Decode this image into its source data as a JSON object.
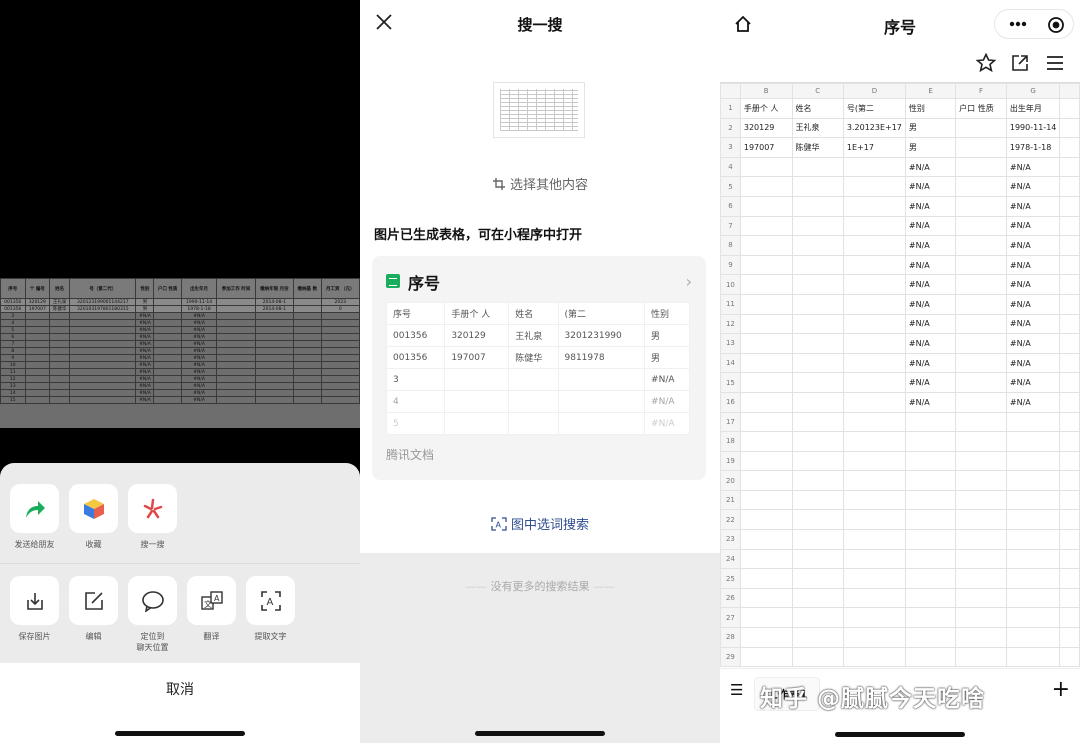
{
  "panel1": {
    "photo": {
      "headers": [
        "序号",
        "个\n编号",
        "姓名",
        "号（第二代）",
        "性别",
        "户口\n性质",
        "出生年月",
        "参加工作\n时间",
        "缴纳年限\n月份",
        "缴纳基\n数",
        "月工资\n（元）"
      ],
      "rows": [
        [
          "001356",
          "320129",
          "王礼泉",
          "320123199001144217",
          "男",
          "",
          "1990-11-14",
          "",
          "2014-08-1",
          "",
          "2023"
        ],
        [
          "001356",
          "197007",
          "陈健华",
          "320103197801180315",
          "男",
          "",
          "1978-1-18",
          "",
          "2014-08-1",
          "",
          "0"
        ],
        [
          "3",
          "",
          "",
          "",
          "#N/A",
          "",
          "#N/A",
          "",
          "",
          "",
          ""
        ],
        [
          "4",
          "",
          "",
          "",
          "#N/A",
          "",
          "#N/A",
          "",
          "",
          "",
          ""
        ],
        [
          "5",
          "",
          "",
          "",
          "#N/A",
          "",
          "#N/A",
          "",
          "",
          "",
          ""
        ],
        [
          "6",
          "",
          "",
          "",
          "#N/A",
          "",
          "#N/A",
          "",
          "",
          "",
          ""
        ],
        [
          "7",
          "",
          "",
          "",
          "#N/A",
          "",
          "#N/A",
          "",
          "",
          "",
          ""
        ],
        [
          "8",
          "",
          "",
          "",
          "#N/A",
          "",
          "#N/A",
          "",
          "",
          "",
          ""
        ],
        [
          "9",
          "",
          "",
          "",
          "#N/A",
          "",
          "#N/A",
          "",
          "",
          "",
          ""
        ],
        [
          "10",
          "",
          "",
          "",
          "#N/A",
          "",
          "#N/A",
          "",
          "",
          "",
          ""
        ],
        [
          "11",
          "",
          "",
          "",
          "#N/A",
          "",
          "#N/A",
          "",
          "",
          "",
          ""
        ],
        [
          "12",
          "",
          "",
          "",
          "#N/A",
          "",
          "#N/A",
          "",
          "",
          "",
          ""
        ],
        [
          "13",
          "",
          "",
          "",
          "#N/A",
          "",
          "#N/A",
          "",
          "",
          "",
          ""
        ],
        [
          "14",
          "",
          "",
          "",
          "#N/A",
          "",
          "#N/A",
          "",
          "",
          "",
          ""
        ],
        [
          "15",
          "",
          "",
          "",
          "#N/A",
          "",
          "#N/A",
          "",
          "",
          "",
          ""
        ]
      ]
    },
    "actions_row1": [
      {
        "label": "发送给朋友",
        "icon": "share-arrow-icon"
      },
      {
        "label": "收藏",
        "icon": "favorite-cube-icon"
      },
      {
        "label": "搜一搜",
        "icon": "search-star-icon"
      }
    ],
    "actions_row2": [
      {
        "label": "保存图片",
        "icon": "save-download-icon"
      },
      {
        "label": "编辑",
        "icon": "edit-pencil-icon"
      },
      {
        "label": "定位到\n聊天位置",
        "icon": "chat-bubble-icon"
      },
      {
        "label": "翻译",
        "icon": "translate-icon"
      },
      {
        "label": "提取文字",
        "icon": "extract-text-icon"
      }
    ],
    "cancel_label": "取消",
    "arrow_color": "#e07060"
  },
  "panel2": {
    "title": "搜一搜",
    "select_other": "选择其他内容",
    "generated_text": "图片已生成表格，可在小程序中打开",
    "card": {
      "title": "序号",
      "table": [
        [
          "序号",
          "手册个 人",
          "姓名",
          "(第二",
          "性别"
        ],
        [
          "001356",
          "320129",
          "王礼泉",
          "3201231990",
          "男"
        ],
        [
          "001356",
          "197007",
          "陈健华",
          "9811978",
          "男"
        ],
        [
          "3",
          "",
          "",
          "",
          "#N/A"
        ],
        [
          "4",
          "",
          "",
          "",
          "#N/A"
        ],
        [
          "5",
          "",
          "",
          "",
          "#N/A"
        ]
      ],
      "source": "腾讯文档"
    },
    "image_word_search": "图中选词搜索",
    "no_more": "没有更多的搜索结果"
  },
  "panel3": {
    "title": "序号",
    "column_letters": [
      "",
      "B",
      "C",
      "D",
      "E",
      "F",
      "G"
    ],
    "row1": [
      "1",
      "手册个 人",
      "姓名",
      "号(第二",
      "性别",
      "户口 性质",
      "出生年月"
    ],
    "row2": [
      "2",
      "320129",
      "王礼泉",
      "3.20123E+17",
      "男",
      "",
      "1990-11-14"
    ],
    "row3": [
      "3",
      "197007",
      "陈健华",
      "1E+17",
      "男",
      "",
      "1978-1-18"
    ],
    "na_text": "#N/A",
    "na_rows": [
      "4",
      "5",
      "6",
      "7",
      "8",
      "9",
      "10",
      "11",
      "12",
      "13",
      "14",
      "15",
      "16"
    ],
    "empty_rows": [
      "17",
      "18",
      "19",
      "20",
      "21",
      "22",
      "23",
      "24",
      "25",
      "26",
      "27",
      "28",
      "29"
    ],
    "sheet_tab": "工作表1",
    "watermark": "知乎 @腻腻今天吃啥"
  }
}
